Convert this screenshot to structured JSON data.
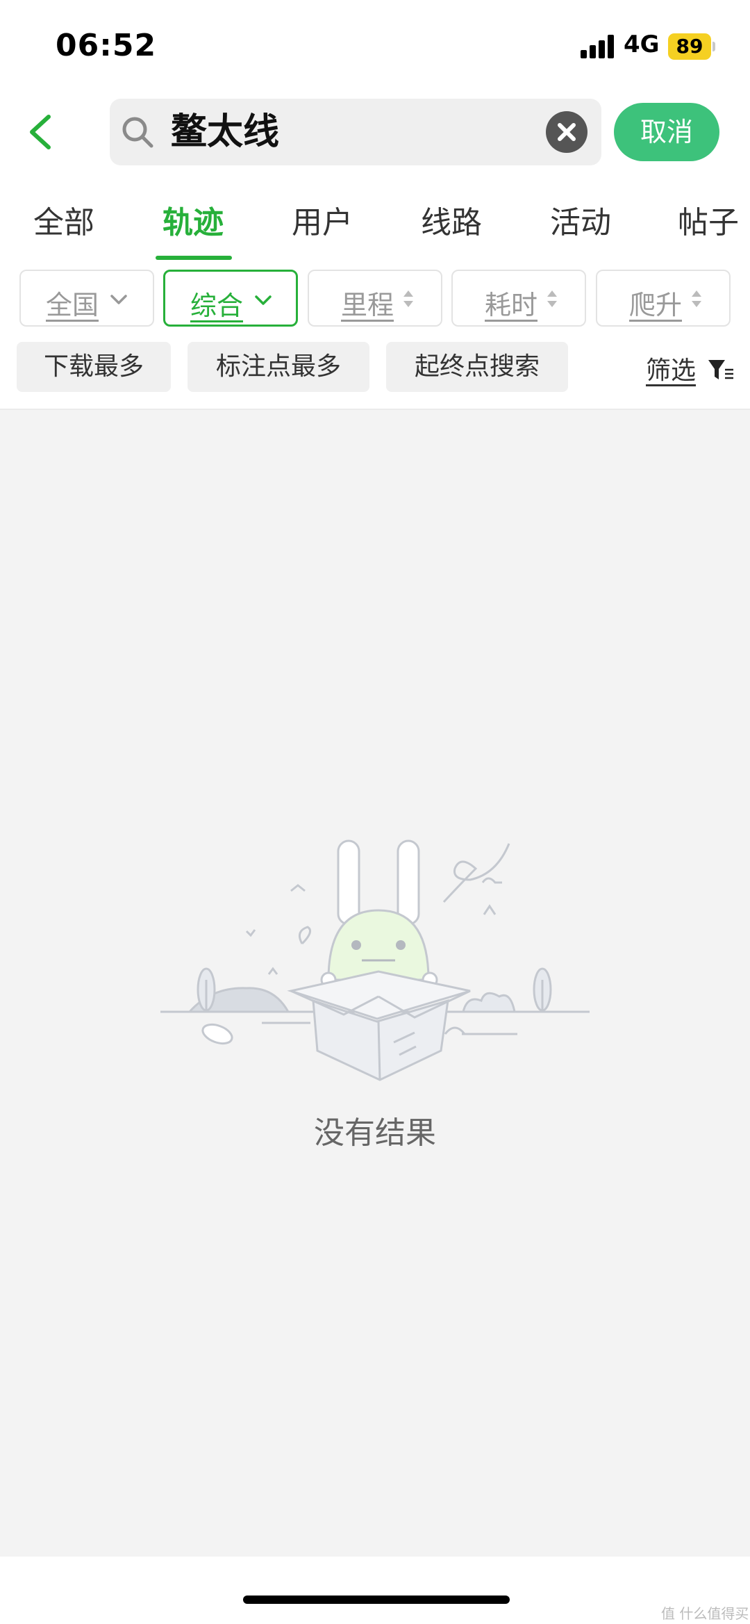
{
  "status_bar": {
    "time": "06:52",
    "network": "4G",
    "battery": "89"
  },
  "search": {
    "query": "鳌太线",
    "cancel_label": "取消"
  },
  "tabs": [
    {
      "label": "全部",
      "active": false
    },
    {
      "label": "轨迹",
      "active": true
    },
    {
      "label": "用户",
      "active": false
    },
    {
      "label": "线路",
      "active": false
    },
    {
      "label": "活动",
      "active": false
    },
    {
      "label": "帖子",
      "active": false
    }
  ],
  "filters": [
    {
      "label": "全国",
      "type": "dropdown"
    },
    {
      "label": "综合",
      "type": "dropdown",
      "active": true
    },
    {
      "label": "里程",
      "type": "sort"
    },
    {
      "label": "耗时",
      "type": "sort"
    },
    {
      "label": "爬升",
      "type": "sort"
    }
  ],
  "quick_filters": [
    "下载最多",
    "标注点最多",
    "起终点搜索"
  ],
  "filter_link": "筛选",
  "empty_state": {
    "message": "没有结果"
  },
  "watermark": "值 什么值得买",
  "colors": {
    "accent": "#27b03a",
    "cancel_button": "#3dc27b",
    "battery": "#f5d022",
    "content_bg": "#f3f3f3"
  }
}
